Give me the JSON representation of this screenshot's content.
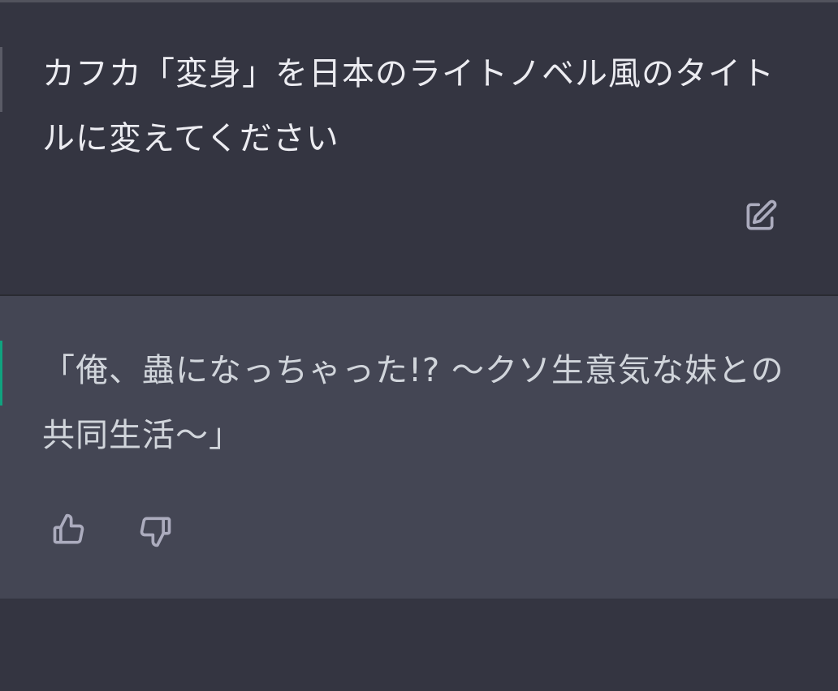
{
  "conversation": {
    "user_message": {
      "text": "カフカ「変身」を日本のライトノベル風のタイトルに変えてください",
      "edit_icon": "edit-icon"
    },
    "assistant_message": {
      "text": "「俺、蟲になっちゃった!? 〜クソ生意気な妹との共同生活〜」",
      "thumbs_up_icon": "thumbs-up-icon",
      "thumbs_down_icon": "thumbs-down-icon",
      "accent_color": "#10a37f"
    }
  },
  "colors": {
    "user_bg": "#343541",
    "assistant_bg": "#444654",
    "text": "#ececf1",
    "icon": "#acacbe"
  }
}
